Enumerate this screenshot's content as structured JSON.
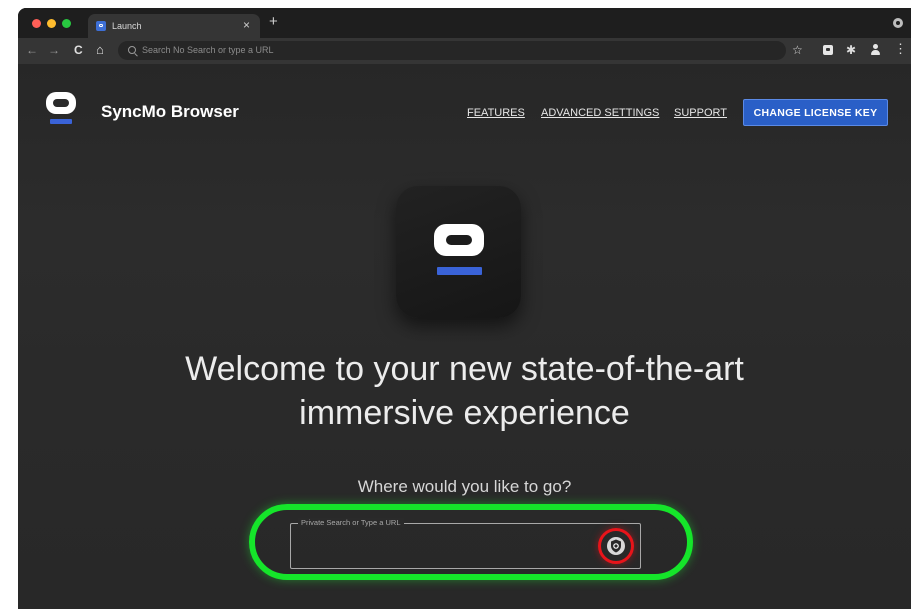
{
  "browser": {
    "tab": {
      "title": "Launch",
      "close_glyph": "×"
    },
    "new_tab_glyph": "+",
    "omnibox": {
      "placeholder": "Search No Search or type a URL"
    },
    "nav": {
      "back_glyph": "←",
      "forward_glyph": "→",
      "reload_glyph": "C",
      "home_glyph": "⌂"
    },
    "toolbar_icons": {
      "bookmark_glyph": "☆",
      "extensions_glyph": "✱",
      "menu_glyph": "⋮"
    }
  },
  "site": {
    "brand": "SyncMo Browser",
    "nav": [
      {
        "label": "FEATURES"
      },
      {
        "label": "ADVANCED SETTINGS"
      },
      {
        "label": "SUPPORT"
      }
    ],
    "cta_label": "CHANGE LICENSE KEY",
    "headline_line1": "Welcome to your new state-of-the-art",
    "headline_line2": "immersive experience",
    "subhead": "Where would you like to go?",
    "search": {
      "label": "Private Search or Type a URL",
      "value": ""
    }
  },
  "colors": {
    "accent": "#2a5fc7",
    "highlight_green": "#15e52a",
    "highlight_red": "#e8141a",
    "background": "#2a2a2a"
  },
  "icons": {
    "app_logo": "syncmo-logo-icon",
    "shield": "shield-icon",
    "search": "search-icon"
  }
}
